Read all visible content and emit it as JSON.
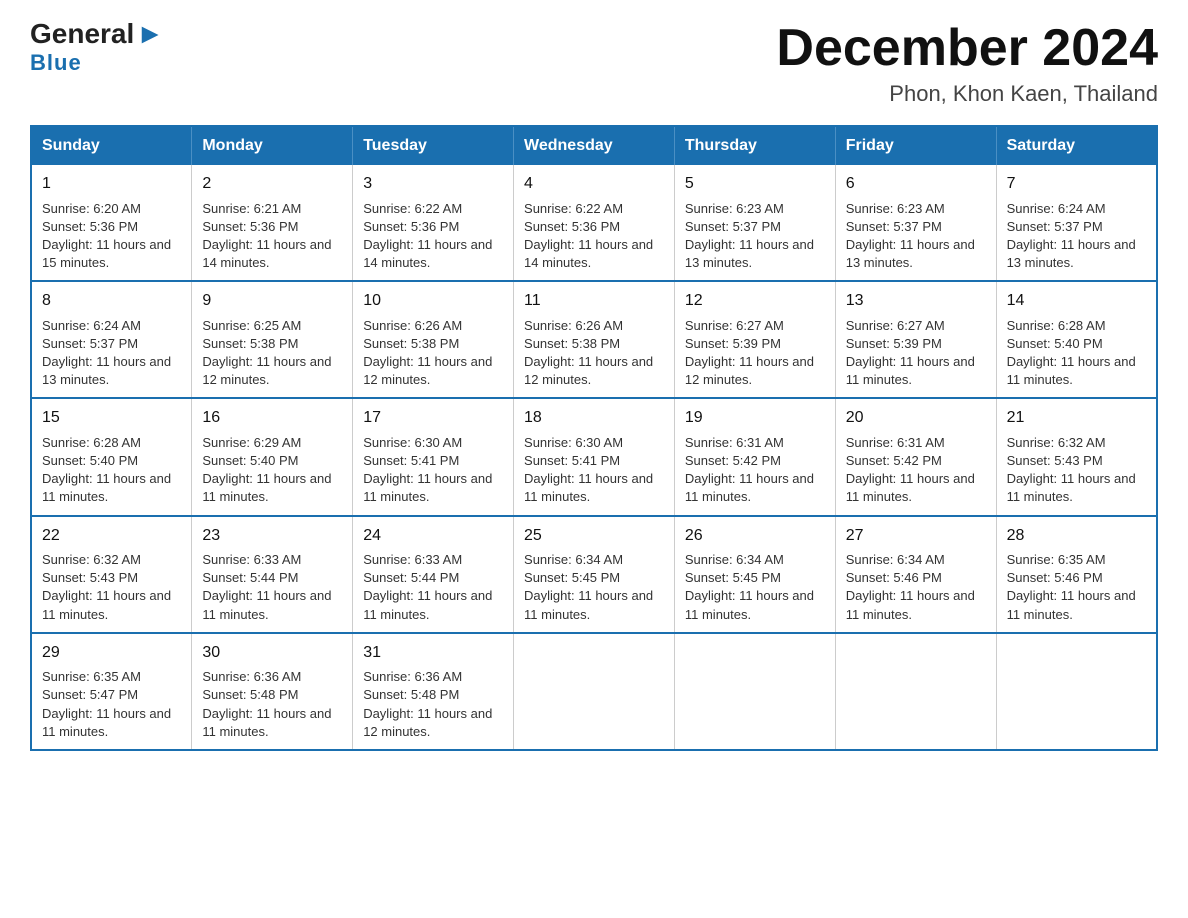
{
  "header": {
    "logo_general": "General",
    "logo_arrow": "▶",
    "logo_blue": "Blue",
    "month_title": "December 2024",
    "location": "Phon, Khon Kaen, Thailand"
  },
  "days_of_week": [
    "Sunday",
    "Monday",
    "Tuesday",
    "Wednesday",
    "Thursday",
    "Friday",
    "Saturday"
  ],
  "weeks": [
    [
      {
        "day": "1",
        "sunrise": "6:20 AM",
        "sunset": "5:36 PM",
        "daylight": "11 hours and 15 minutes."
      },
      {
        "day": "2",
        "sunrise": "6:21 AM",
        "sunset": "5:36 PM",
        "daylight": "11 hours and 14 minutes."
      },
      {
        "day": "3",
        "sunrise": "6:22 AM",
        "sunset": "5:36 PM",
        "daylight": "11 hours and 14 minutes."
      },
      {
        "day": "4",
        "sunrise": "6:22 AM",
        "sunset": "5:36 PM",
        "daylight": "11 hours and 14 minutes."
      },
      {
        "day": "5",
        "sunrise": "6:23 AM",
        "sunset": "5:37 PM",
        "daylight": "11 hours and 13 minutes."
      },
      {
        "day": "6",
        "sunrise": "6:23 AM",
        "sunset": "5:37 PM",
        "daylight": "11 hours and 13 minutes."
      },
      {
        "day": "7",
        "sunrise": "6:24 AM",
        "sunset": "5:37 PM",
        "daylight": "11 hours and 13 minutes."
      }
    ],
    [
      {
        "day": "8",
        "sunrise": "6:24 AM",
        "sunset": "5:37 PM",
        "daylight": "11 hours and 13 minutes."
      },
      {
        "day": "9",
        "sunrise": "6:25 AM",
        "sunset": "5:38 PM",
        "daylight": "11 hours and 12 minutes."
      },
      {
        "day": "10",
        "sunrise": "6:26 AM",
        "sunset": "5:38 PM",
        "daylight": "11 hours and 12 minutes."
      },
      {
        "day": "11",
        "sunrise": "6:26 AM",
        "sunset": "5:38 PM",
        "daylight": "11 hours and 12 minutes."
      },
      {
        "day": "12",
        "sunrise": "6:27 AM",
        "sunset": "5:39 PM",
        "daylight": "11 hours and 12 minutes."
      },
      {
        "day": "13",
        "sunrise": "6:27 AM",
        "sunset": "5:39 PM",
        "daylight": "11 hours and 11 minutes."
      },
      {
        "day": "14",
        "sunrise": "6:28 AM",
        "sunset": "5:40 PM",
        "daylight": "11 hours and 11 minutes."
      }
    ],
    [
      {
        "day": "15",
        "sunrise": "6:28 AM",
        "sunset": "5:40 PM",
        "daylight": "11 hours and 11 minutes."
      },
      {
        "day": "16",
        "sunrise": "6:29 AM",
        "sunset": "5:40 PM",
        "daylight": "11 hours and 11 minutes."
      },
      {
        "day": "17",
        "sunrise": "6:30 AM",
        "sunset": "5:41 PM",
        "daylight": "11 hours and 11 minutes."
      },
      {
        "day": "18",
        "sunrise": "6:30 AM",
        "sunset": "5:41 PM",
        "daylight": "11 hours and 11 minutes."
      },
      {
        "day": "19",
        "sunrise": "6:31 AM",
        "sunset": "5:42 PM",
        "daylight": "11 hours and 11 minutes."
      },
      {
        "day": "20",
        "sunrise": "6:31 AM",
        "sunset": "5:42 PM",
        "daylight": "11 hours and 11 minutes."
      },
      {
        "day": "21",
        "sunrise": "6:32 AM",
        "sunset": "5:43 PM",
        "daylight": "11 hours and 11 minutes."
      }
    ],
    [
      {
        "day": "22",
        "sunrise": "6:32 AM",
        "sunset": "5:43 PM",
        "daylight": "11 hours and 11 minutes."
      },
      {
        "day": "23",
        "sunrise": "6:33 AM",
        "sunset": "5:44 PM",
        "daylight": "11 hours and 11 minutes."
      },
      {
        "day": "24",
        "sunrise": "6:33 AM",
        "sunset": "5:44 PM",
        "daylight": "11 hours and 11 minutes."
      },
      {
        "day": "25",
        "sunrise": "6:34 AM",
        "sunset": "5:45 PM",
        "daylight": "11 hours and 11 minutes."
      },
      {
        "day": "26",
        "sunrise": "6:34 AM",
        "sunset": "5:45 PM",
        "daylight": "11 hours and 11 minutes."
      },
      {
        "day": "27",
        "sunrise": "6:34 AM",
        "sunset": "5:46 PM",
        "daylight": "11 hours and 11 minutes."
      },
      {
        "day": "28",
        "sunrise": "6:35 AM",
        "sunset": "5:46 PM",
        "daylight": "11 hours and 11 minutes."
      }
    ],
    [
      {
        "day": "29",
        "sunrise": "6:35 AM",
        "sunset": "5:47 PM",
        "daylight": "11 hours and 11 minutes."
      },
      {
        "day": "30",
        "sunrise": "6:36 AM",
        "sunset": "5:48 PM",
        "daylight": "11 hours and 11 minutes."
      },
      {
        "day": "31",
        "sunrise": "6:36 AM",
        "sunset": "5:48 PM",
        "daylight": "11 hours and 12 minutes."
      },
      null,
      null,
      null,
      null
    ]
  ]
}
